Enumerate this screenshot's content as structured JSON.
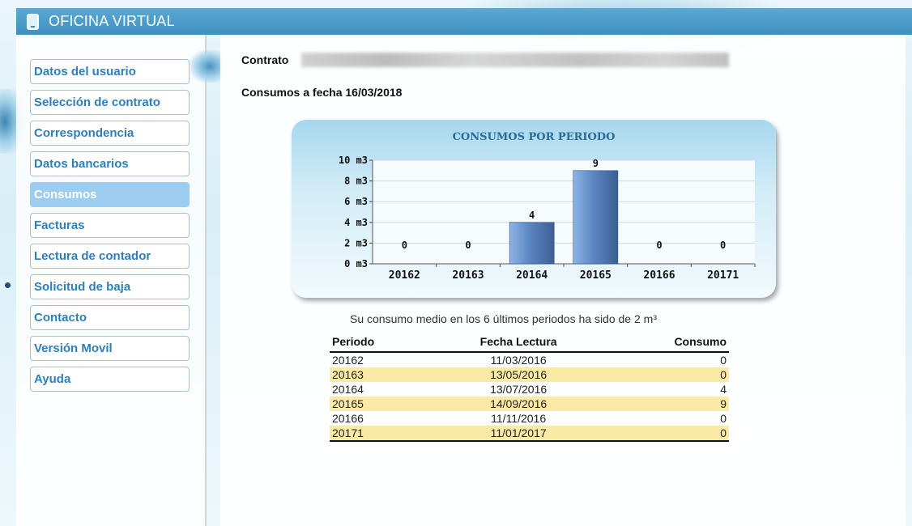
{
  "header": {
    "title": "OFICINA VIRTUAL"
  },
  "sidebar": {
    "items": [
      {
        "label": "Datos del usuario"
      },
      {
        "label": "Selección de contrato"
      },
      {
        "label": "Correspondencia"
      },
      {
        "label": "Datos bancarios"
      },
      {
        "label": "Consumos"
      },
      {
        "label": "Facturas"
      },
      {
        "label": "Lectura de contador"
      },
      {
        "label": "Solicitud de baja"
      },
      {
        "label": "Contacto"
      },
      {
        "label": "Versión Movil"
      },
      {
        "label": "Ayuda"
      }
    ],
    "active": "Consumos"
  },
  "main": {
    "contrato_label": "Contrato",
    "fecha_label": "Consumos a fecha 16/03/2018",
    "average_text": "Su consumo medio en los 6 últimos periodos ha sido de 2 m³"
  },
  "chart_data": {
    "type": "bar",
    "title": "CONSUMOS POR PERIODO",
    "categories": [
      "20162",
      "20163",
      "20164",
      "20165",
      "20166",
      "20171"
    ],
    "values": [
      0,
      0,
      4,
      9,
      0,
      0
    ],
    "data_labels": [
      "0",
      "0",
      "4",
      "9",
      "0",
      "0"
    ],
    "y_ticks": [
      "0 m3",
      "2 m3",
      "4 m3",
      "6 m3",
      "8 m3",
      "10 m3"
    ],
    "ylim": [
      0,
      10
    ],
    "grid": true,
    "bar_color": "#5b86c2"
  },
  "table": {
    "headers": [
      "Periodo",
      "Fecha Lectura",
      "Consumo"
    ],
    "rows": [
      [
        "20162",
        "11/03/2016",
        "0"
      ],
      [
        "20163",
        "13/05/2016",
        "0"
      ],
      [
        "20164",
        "13/07/2016",
        "4"
      ],
      [
        "20165",
        "14/09/2016",
        "9"
      ],
      [
        "20166",
        "11/11/2016",
        "0"
      ],
      [
        "20171",
        "11/01/2017",
        "0"
      ]
    ]
  },
  "colors": {
    "header": "#4a9cc9",
    "menu_text": "#2e7fb8",
    "menu_active": "#9ccdf0",
    "row_highlight": "#fbeaa5"
  }
}
